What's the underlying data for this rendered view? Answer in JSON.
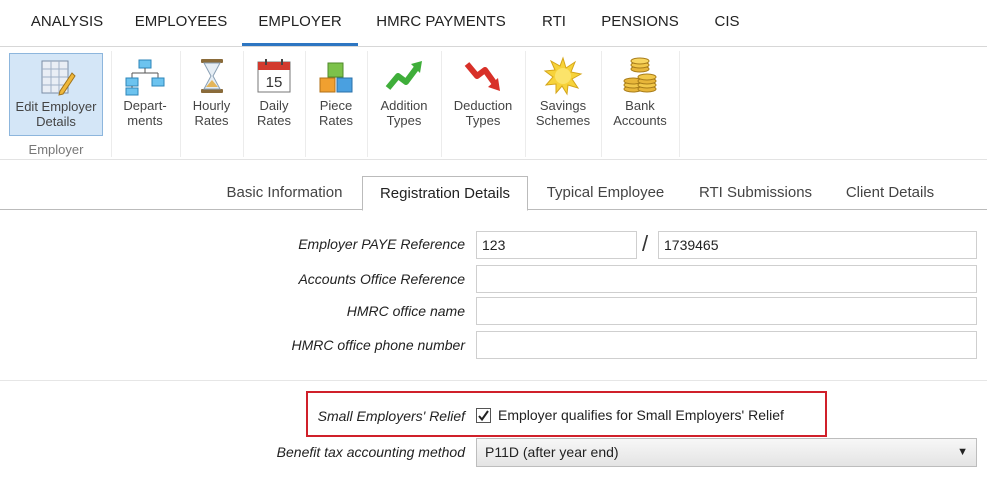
{
  "topnav": {
    "tabs": [
      {
        "label": "ANALYSIS"
      },
      {
        "label": "EMPLOYEES"
      },
      {
        "label": "EMPLOYER"
      },
      {
        "label": "HMRC PAYMENTS"
      },
      {
        "label": "RTI"
      },
      {
        "label": "PENSIONS"
      },
      {
        "label": "CIS"
      }
    ],
    "active": "EMPLOYER"
  },
  "ribbon": {
    "group_label": "Employer",
    "buttons": [
      {
        "line1": "Edit Employer",
        "line2": "Details",
        "icon": "edit-employer-icon"
      },
      {
        "line1": "Depart-",
        "line2": "ments",
        "icon": "org-chart-icon"
      },
      {
        "line1": "Hourly",
        "line2": "Rates",
        "icon": "hourglass-icon"
      },
      {
        "line1": "Daily",
        "line2": "Rates",
        "icon": "calendar-icon",
        "calendar_day": "15"
      },
      {
        "line1": "Piece",
        "line2": "Rates",
        "icon": "blocks-icon"
      },
      {
        "line1": "Addition",
        "line2": "Types",
        "icon": "arrow-up-icon"
      },
      {
        "line1": "Deduction",
        "line2": "Types",
        "icon": "arrow-down-icon"
      },
      {
        "line1": "Savings",
        "line2": "Schemes",
        "icon": "sun-icon"
      },
      {
        "line1": "Bank",
        "line2": "Accounts",
        "icon": "coins-icon"
      }
    ]
  },
  "subtabs": [
    {
      "label": "Basic Information"
    },
    {
      "label": "Registration Details"
    },
    {
      "label": "Typical Employee"
    },
    {
      "label": "RTI Submissions"
    },
    {
      "label": "Client Details"
    }
  ],
  "subtabs_active": "Registration Details",
  "form": {
    "paye_label": "Employer PAYE Reference",
    "paye_office": "123",
    "paye_separator": "/",
    "paye_ref": "1739465",
    "accounts_office_label": "Accounts Office Reference",
    "accounts_office_value": "",
    "hmrc_office_name_label": "HMRC office name",
    "hmrc_office_name_value": "",
    "hmrc_phone_label": "HMRC office phone number",
    "hmrc_phone_value": "",
    "ser_label": "Small Employers' Relief",
    "ser_checkbox_label": "Employer qualifies for Small Employers' Relief",
    "ser_checked": true,
    "benefit_label": "Benefit tax accounting method",
    "benefit_value": "P11D (after year end)"
  },
  "colors": {
    "accent": "#2d76c2",
    "highlight_border": "#d0202a",
    "active_button_bg": "#d4e6f7"
  }
}
